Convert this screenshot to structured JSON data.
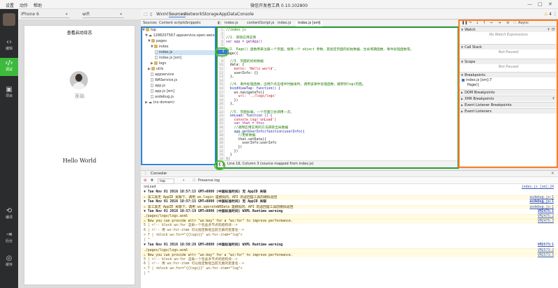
{
  "app": {
    "title": "微信开发者工具 0.10.102800",
    "menus": [
      "设置",
      "动作",
      "帮助"
    ],
    "window_buttons": [
      "—",
      "□",
      "✕"
    ]
  },
  "sidebar": {
    "items": [
      {
        "label": "编辑",
        "icon": "code-icon"
      },
      {
        "label": "调试",
        "icon": "debug-icon"
      },
      {
        "label": "项目",
        "icon": "project-icon"
      },
      {
        "label": "编译",
        "icon": "compile-icon"
      },
      {
        "label": "后台",
        "icon": "background-icon"
      },
      {
        "label": "缓存",
        "icon": "cache-icon"
      }
    ]
  },
  "simulator": {
    "device": "iPhone 6",
    "network": "wifi",
    "page_title": "查看启动日志",
    "nickname": "莲瑜",
    "hello": "Hello World"
  },
  "devtools": {
    "tabs": [
      "Wxml",
      "Sources",
      "Network",
      "Storage",
      "AppData",
      "Console"
    ],
    "warning_count": "4",
    "sources_subtabs": [
      "Sources",
      "Content scripts",
      "Snippets"
    ]
  },
  "filetree": [
    {
      "label": "top",
      "type": "folder"
    },
    {
      "label": "1288207567.appservice.open.weixin.q",
      "type": "cloud"
    },
    {
      "label": "pages",
      "type": "folder"
    },
    {
      "label": "index",
      "type": "folder"
    },
    {
      "label": "index.js",
      "type": "file"
    },
    {
      "label": "index.js [sm]",
      "type": "file"
    },
    {
      "label": "logs",
      "type": "folder"
    },
    {
      "label": "utils",
      "type": "folder"
    },
    {
      "label": "appservice",
      "type": "file"
    },
    {
      "label": "WAService.js",
      "type": "file"
    },
    {
      "label": "app.js",
      "type": "file"
    },
    {
      "label": "app.js [sm]",
      "type": "file"
    },
    {
      "label": "asdebug.js",
      "type": "file"
    },
    {
      "label": "(no domain)",
      "type": "cloud"
    }
  ],
  "editor": {
    "tabs": [
      "index.js",
      "contentScript.js",
      "index.js",
      "index.js [sm]"
    ],
    "gutter_marker": "5",
    "lines": [
      "//index.js",
      "",
      "//1. 获取应用实例",
      "var app = getApp()",
      "",
      "//2. Page() 函数用来注册一个页面。接受一个 object 参数，其指定页面的初始数据、生命周期函数、事件处理函数等。",
      "Page({",
      "",
      "  //3. 页面的初始数据",
      "  data: {",
      "    motto: 'Hello world',",
      "    userInfo: {}",
      "  },",
      "",
      "  //4. 事件处理函数，当用户点击组件时触发时，调用该事件处理函数，跳转到logs页面。",
      "  bindViewTap: function() {",
      "    wx.navigateTo({",
      "      url: '../logs/logs'",
      "    })",
      "  },",
      "",
      "  //5. 页面加载，一个页面只会调用一次。",
      "  onLoad: function () {",
      "    console.log('onLoad')",
      "    var that = this",
      "    //调用应用实例的方法获取全局数据",
      "    app.getUserInfo(function(userInfo){",
      "      //更新数据",
      "      that.setData({",
      "        userInfo:userInfo",
      "      })",
      "    })",
      "  }",
      "})"
    ],
    "status": "Line 16, Column 3   (source mapped from index.js)"
  },
  "debugger": {
    "async_label": "Async",
    "watch": {
      "title": "Watch",
      "empty": "No Watch Expressions"
    },
    "call_stack": {
      "title": "Call Stack",
      "empty": "Not Paused"
    },
    "scope": {
      "title": "Scope",
      "empty": "Not Paused"
    },
    "breakpoints": {
      "title": "Breakpoints",
      "items": [
        "index.js [sm]:7",
        "Page({"
      ]
    },
    "other_panes": [
      "DOM Breakpoints",
      "XHR Breakpoints",
      "Event Listener Breakpoints",
      "Event Listeners"
    ]
  },
  "console": {
    "tab_label": "Console",
    "filter": "top",
    "preserve_log": "Preserve log",
    "rows": [
      {
        "text": "onLoad",
        "src": "index.js [sm]:24",
        "kind": "log"
      },
      {
        "text": "▼ Tue Nov 01 2016 18:57:15 GMT+0800 (中国标准时间) 无 AppID 关联",
        "src": "",
        "kind": "group"
      },
      {
        "text": "⚠ 该工具无 AppID 关联下，调用 wx.login 是模拟的，API 的返回是工具的模拟返回",
        "src": "asdebug.js:1",
        "kind": "warn"
      },
      {
        "text": "▼ Tue Nov 01 2016 18:57:15 GMT+0800 (中国标准时间) 无 AppID 关联",
        "src": "asdebug.js:1",
        "kind": "group"
      },
      {
        "text": "⚠ 该工具无 AppID 关联下，调用 wx.operateWXData 是模拟的，API 的返回是工具的模拟返回",
        "src": "asdebug.js:1",
        "kind": "warn"
      },
      {
        "text": "▼ Tue Nov 01 2016 18:57:19 GMT+0800 (中国标准时间) WXML Runtime warning",
        "src": "VM2475:1",
        "kind": "group"
      },
      {
        "text": "  ./pages/logs/logs.wxml",
        "src": "VM2475:2",
        "kind": "warn"
      },
      {
        "text": "⚠ Now you can provide attr \"wx:key\" for a \"wx:for\" to improve performance.",
        "src": "VM2475:3",
        "kind": "warn"
      },
      {
        "text": "   5 |   <!-- block wx:for 渲染一个包含多节点的结构块-->",
        "src": "",
        "kind": "code"
      },
      {
        "text": "   6 |   <!-- 用 wx:for-item 可以指定数组当前元素的变量名-->",
        "src": "",
        "kind": "code"
      },
      {
        "text": " > 7 |   <block wx:for=\"{{logs}}\" wx:for-item=\"log\">",
        "src": "",
        "kind": "code"
      },
      {
        "text": "       |   ^",
        "src": "",
        "kind": "code"
      },
      {
        "text": "▼ Tue Nov 01 2016 18:58:28 GMT+0800 (中国标准时间) WXML Runtime warning",
        "src": "VM2573:1",
        "kind": "group"
      },
      {
        "text": "  ./pages/logs/logs.wxml",
        "src": "VM2573:2",
        "kind": "warn"
      },
      {
        "text": "⚠ Now you can provide attr \"wx:key\" for a \"wx:for\" to improve performance.",
        "src": "VM2573:3",
        "kind": "warn"
      },
      {
        "text": "   5 |   <!-- block wx:for 渲染一个包含多节点的结构块-->",
        "src": "",
        "kind": "code"
      },
      {
        "text": "   6 |   <!-- 用 wx:for-item 可以指定数组当前元素的变量名-->",
        "src": "",
        "kind": "code"
      },
      {
        "text": " > 7 |   <block wx:for=\"{{logs}}\" wx:for-item=\"log\">",
        "src": "",
        "kind": "code"
      },
      {
        "text": "       |   ^",
        "src": "",
        "kind": "code"
      }
    ]
  },
  "colors": {
    "sidebar_bg": "#2b2c2e",
    "sidebar_active": "#3cba3c",
    "highlight_blue": "#2f86d6",
    "highlight_green": "#2b9a3a",
    "highlight_orange": "#ff7f24"
  }
}
